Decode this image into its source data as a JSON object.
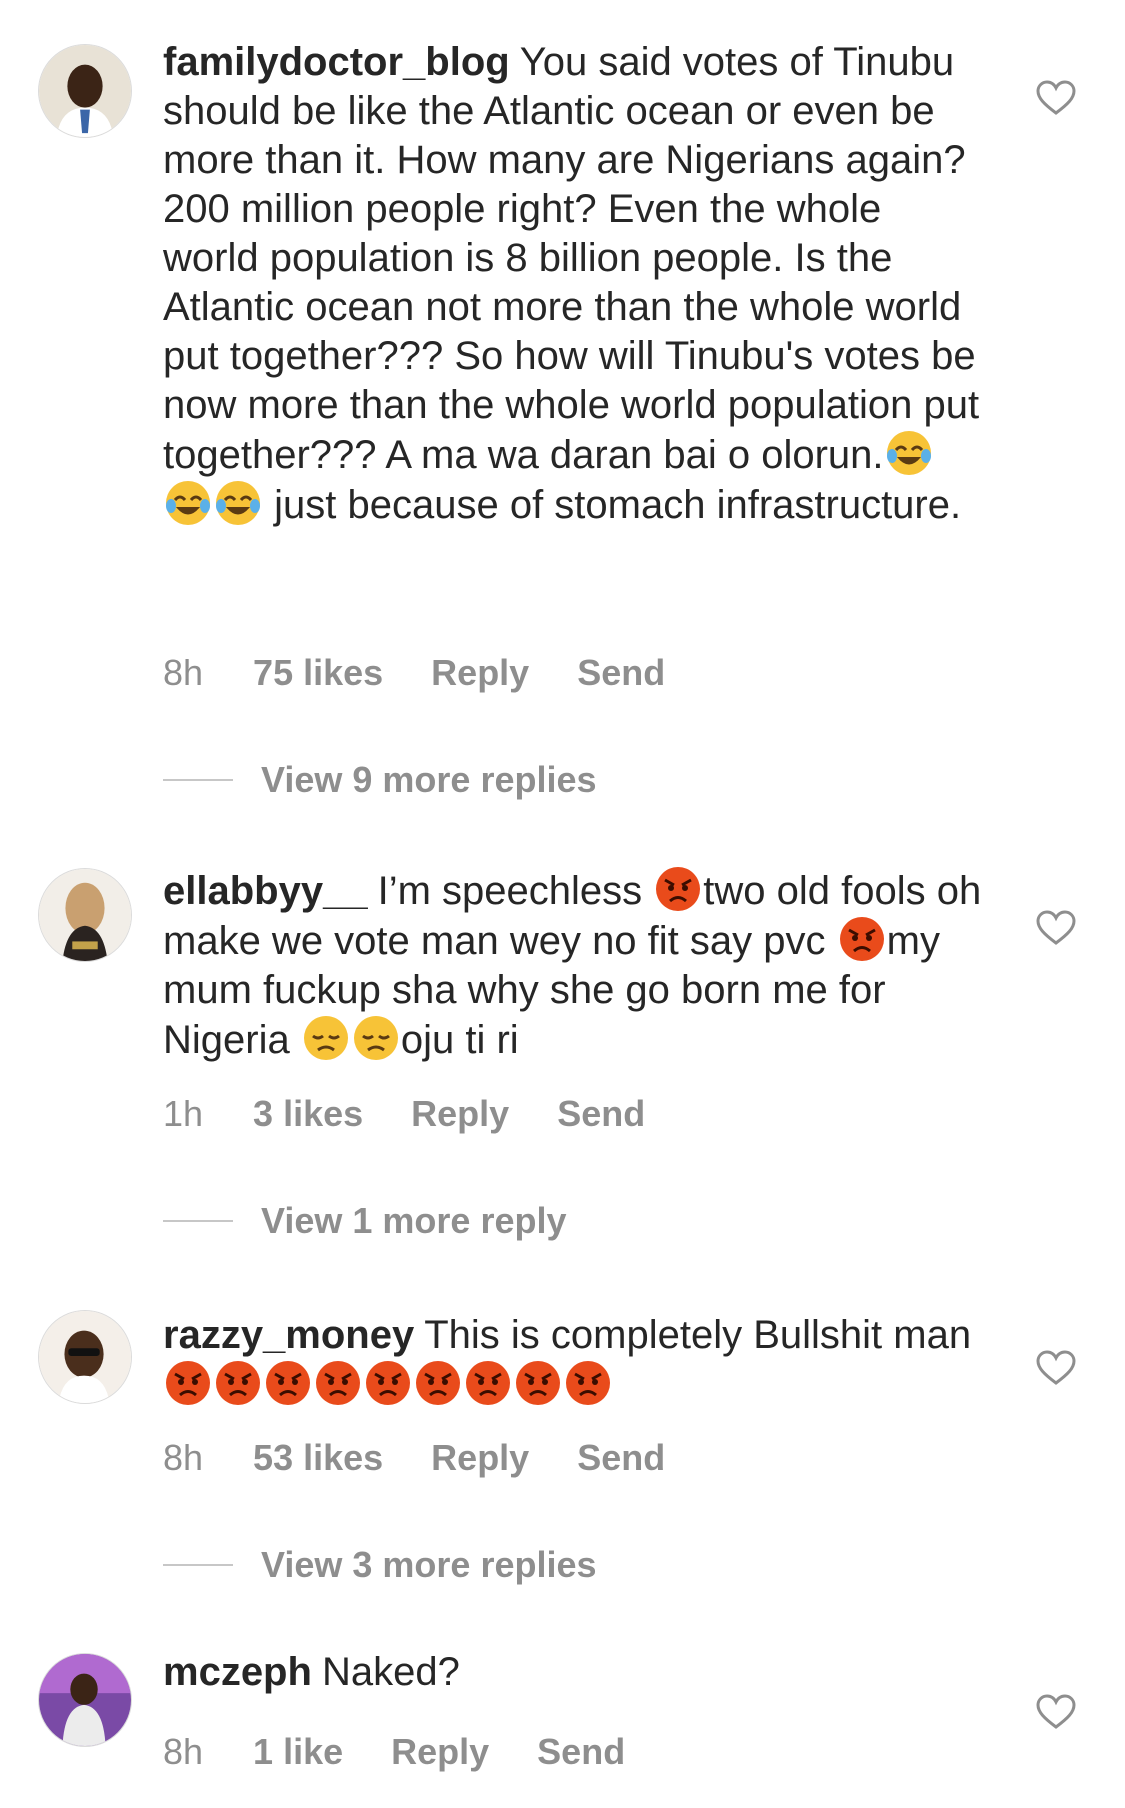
{
  "comments": [
    {
      "username": "familydoctor_blog",
      "text_parts": [
        "You said votes of Tinubu should be like the Atlantic ocean or even be more than it. How many are Nigerians again? 200 million people right? Even the whole world population is 8 billion people. Is the Atlantic ocean not more than the whole world put together??? So how will Tinubu's votes be now more than the whole world population put together??? A ma wa daran bai o olorun.",
        " just because of stomach infrastructure."
      ],
      "emojis": [
        "face-with-tears-of-joy-icon",
        "face-with-tears-of-joy-icon",
        "face-with-tears-of-joy-icon"
      ],
      "time": "8h",
      "likes": "75 likes",
      "reply": "Reply",
      "send": "Send",
      "view_replies": "View 9 more replies"
    },
    {
      "username": "ellabbyy__",
      "text_parts": [
        "I’m speechless ",
        "two old fools oh make we vote man wey no fit say pvc ",
        "my mum fuckup sha why she go born me for Nigeria ",
        "oju ti ri"
      ],
      "emojis": [
        "angry-face-icon",
        "angry-face-icon",
        "disappointed-face-icon",
        "disappointed-face-icon"
      ],
      "time": "1h",
      "likes": "3 likes",
      "reply": "Reply",
      "send": "Send",
      "view_replies": "View 1 more reply"
    },
    {
      "username": "razzy_money",
      "text_parts": [
        "This is completely Bullshit man"
      ],
      "emojis": [
        "angry-face-icon",
        "angry-face-icon",
        "angry-face-icon",
        "angry-face-icon",
        "angry-face-icon",
        "angry-face-icon",
        "angry-face-icon",
        "angry-face-icon",
        "angry-face-icon"
      ],
      "time": "8h",
      "likes": "53 likes",
      "reply": "Reply",
      "send": "Send",
      "view_replies": "View 3 more replies"
    },
    {
      "username": "mczeph",
      "text_parts": [
        "Naked?"
      ],
      "time": "8h",
      "likes": "1 like",
      "reply": "Reply",
      "send": "Send"
    }
  ],
  "colors": {
    "text": "#262626",
    "secondary": "#8e8e8e",
    "divider": "#c7c7c7",
    "angry_emoji": "#e94b1b",
    "joy_emoji": "#f7c337"
  }
}
